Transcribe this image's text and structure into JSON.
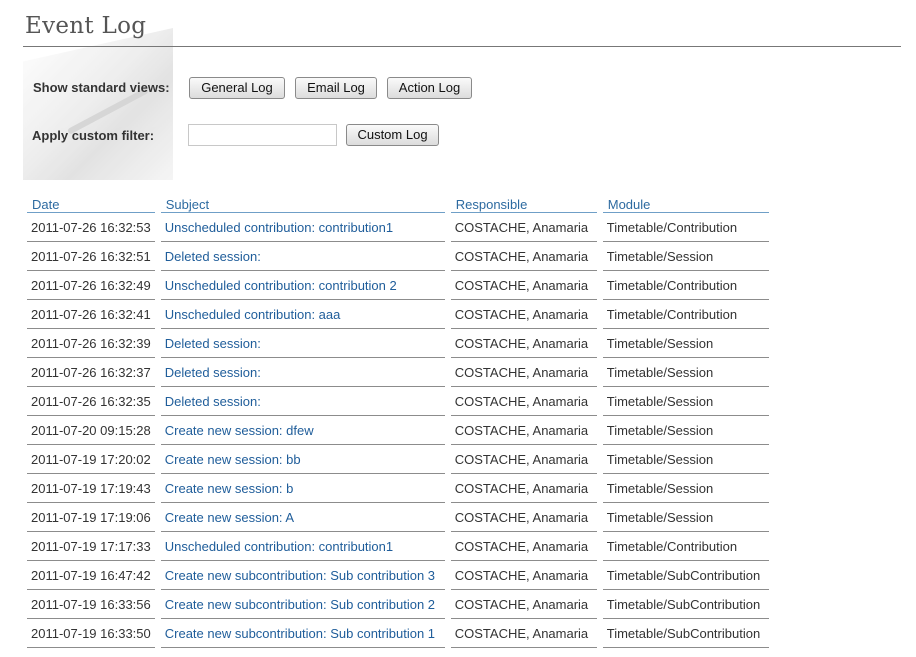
{
  "page": {
    "title": "Event Log"
  },
  "filters": {
    "standard_label": "Show standard views:",
    "buttons": {
      "general": "General Log",
      "email": "Email Log",
      "action": "Action Log"
    },
    "custom_label": "Apply custom filter:",
    "custom_value": "",
    "custom_button": "Custom Log"
  },
  "table": {
    "headers": {
      "date": "Date",
      "subject": "Subject",
      "responsible": "Responsible",
      "module": "Module"
    },
    "rows": [
      {
        "date": "2011-07-26 16:32:53",
        "subject": "Unscheduled contribution: contribution1",
        "responsible": "COSTACHE, Anamaria",
        "module": "Timetable/Contribution"
      },
      {
        "date": "2011-07-26 16:32:51",
        "subject": "Deleted session:",
        "responsible": "COSTACHE, Anamaria",
        "module": "Timetable/Session"
      },
      {
        "date": "2011-07-26 16:32:49",
        "subject": "Unscheduled contribution: contribution 2",
        "responsible": "COSTACHE, Anamaria",
        "module": "Timetable/Contribution"
      },
      {
        "date": "2011-07-26 16:32:41",
        "subject": "Unscheduled contribution: aaa",
        "responsible": "COSTACHE, Anamaria",
        "module": "Timetable/Contribution"
      },
      {
        "date": "2011-07-26 16:32:39",
        "subject": "Deleted session:",
        "responsible": "COSTACHE, Anamaria",
        "module": "Timetable/Session"
      },
      {
        "date": "2011-07-26 16:32:37",
        "subject": "Deleted session:",
        "responsible": "COSTACHE, Anamaria",
        "module": "Timetable/Session"
      },
      {
        "date": "2011-07-26 16:32:35",
        "subject": "Deleted session:",
        "responsible": "COSTACHE, Anamaria",
        "module": "Timetable/Session"
      },
      {
        "date": "2011-07-20 09:15:28",
        "subject": "Create new session: dfew",
        "responsible": "COSTACHE, Anamaria",
        "module": "Timetable/Session"
      },
      {
        "date": "2011-07-19 17:20:02",
        "subject": "Create new session: bb",
        "responsible": "COSTACHE, Anamaria",
        "module": "Timetable/Session"
      },
      {
        "date": "2011-07-19 17:19:43",
        "subject": "Create new session: b",
        "responsible": "COSTACHE, Anamaria",
        "module": "Timetable/Session"
      },
      {
        "date": "2011-07-19 17:19:06",
        "subject": "Create new session: A",
        "responsible": "COSTACHE, Anamaria",
        "module": "Timetable/Session"
      },
      {
        "date": "2011-07-19 17:17:33",
        "subject": "Unscheduled contribution: contribution1",
        "responsible": "COSTACHE, Anamaria",
        "module": "Timetable/Contribution"
      },
      {
        "date": "2011-07-19 16:47:42",
        "subject": "Create new subcontribution: Sub contribution 3",
        "responsible": "COSTACHE, Anamaria",
        "module": "Timetable/SubContribution"
      },
      {
        "date": "2011-07-19 16:33:56",
        "subject": "Create new subcontribution: Sub contribution 2",
        "responsible": "COSTACHE, Anamaria",
        "module": "Timetable/SubContribution"
      },
      {
        "date": "2011-07-19 16:33:50",
        "subject": "Create new subcontribution: Sub contribution 1",
        "responsible": "COSTACHE, Anamaria",
        "module": "Timetable/SubContribution"
      }
    ]
  }
}
